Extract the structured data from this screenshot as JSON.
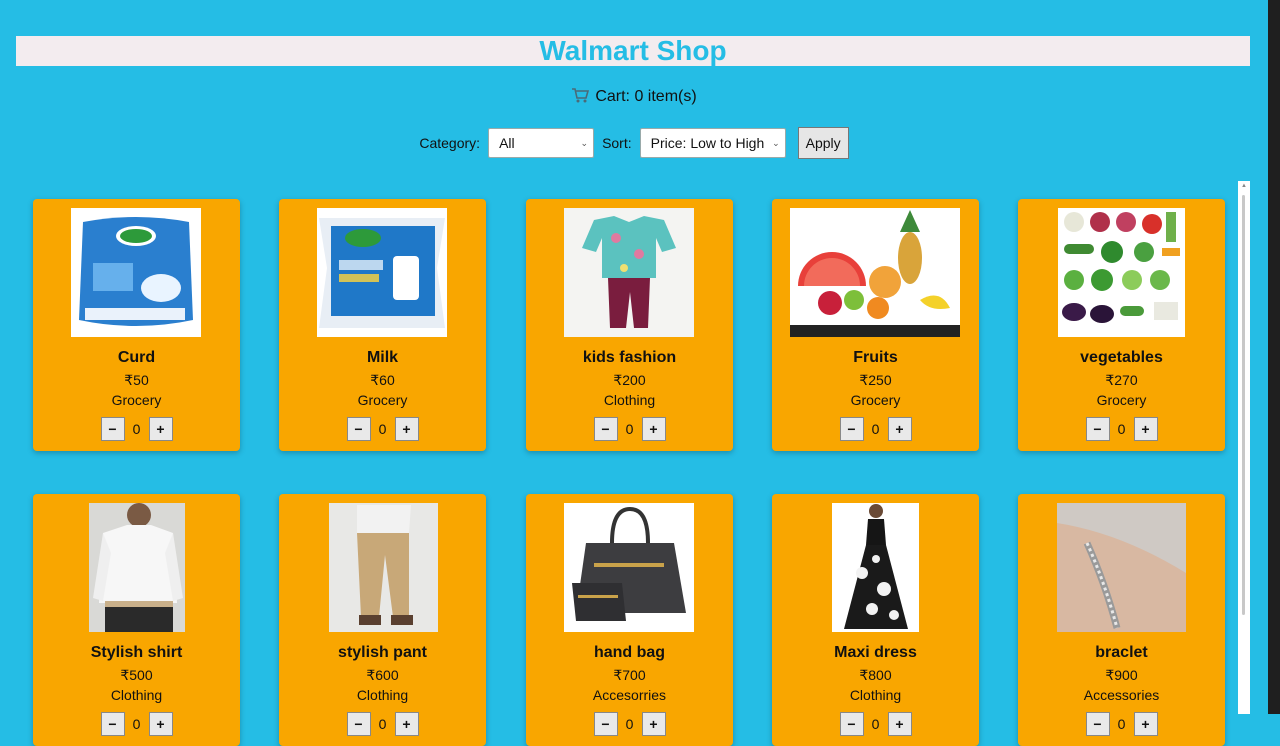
{
  "header": {
    "title": "Walmart Shop"
  },
  "cart": {
    "icon": "cart-icon",
    "label": "Cart: 0 item(s)"
  },
  "filters": {
    "category_label": "Category:",
    "category_value": "All",
    "sort_label": "Sort:",
    "sort_value": "Price: Low to High",
    "apply_label": "Apply"
  },
  "controls": {
    "minus": "−",
    "plus": "+"
  },
  "products": [
    {
      "name": "Curd",
      "price": "₹50",
      "category": "Grocery",
      "qty": "0",
      "image": "curd-image"
    },
    {
      "name": "Milk",
      "price": "₹60",
      "category": "Grocery",
      "qty": "0",
      "image": "milk-image"
    },
    {
      "name": "kids fashion",
      "price": "₹200",
      "category": "Clothing",
      "qty": "0",
      "image": "kids-fashion-image"
    },
    {
      "name": "Fruits",
      "price": "₹250",
      "category": "Grocery",
      "qty": "0",
      "image": "fruits-image"
    },
    {
      "name": "vegetables",
      "price": "₹270",
      "category": "Grocery",
      "qty": "0",
      "image": "vegetables-image"
    },
    {
      "name": "Stylish shirt",
      "price": "₹500",
      "category": "Clothing",
      "qty": "0",
      "image": "shirt-image"
    },
    {
      "name": "stylish pant",
      "price": "₹600",
      "category": "Clothing",
      "qty": "0",
      "image": "pant-image"
    },
    {
      "name": "hand bag",
      "price": "₹700",
      "category": "Accesorries",
      "qty": "0",
      "image": "handbag-image"
    },
    {
      "name": "Maxi dress",
      "price": "₹800",
      "category": "Clothing",
      "qty": "0",
      "image": "dress-image"
    },
    {
      "name": "braclet",
      "price": "₹900",
      "category": "Accessories",
      "qty": "0",
      "image": "bracelet-image"
    }
  ],
  "colors": {
    "background": "#25bde5",
    "card": "#f9a600",
    "title_text": "#25bde5"
  }
}
